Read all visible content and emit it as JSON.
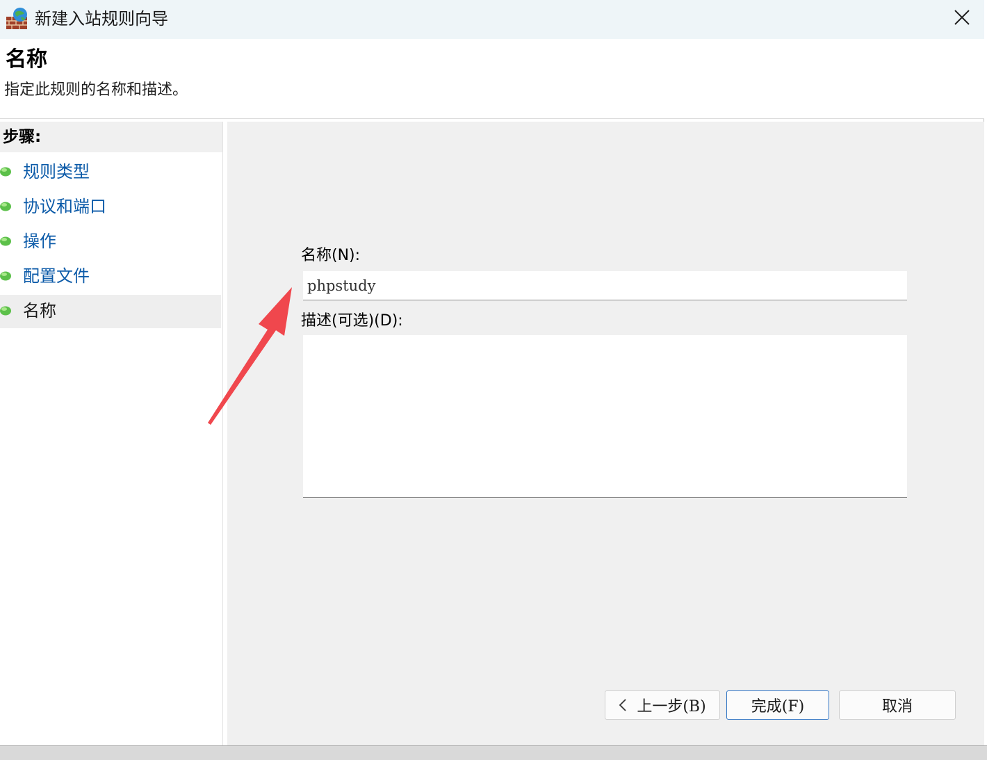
{
  "window": {
    "title": "新建入站规则向导",
    "icon": "firewall-globe-icon",
    "close_icon": "close-icon"
  },
  "header": {
    "title": "名称",
    "subtitle": "指定此规则的名称和描述。"
  },
  "sidebar": {
    "steps_label": "步骤:",
    "items": [
      {
        "label": "规则类型",
        "current": false
      },
      {
        "label": "协议和端口",
        "current": false
      },
      {
        "label": "操作",
        "current": false
      },
      {
        "label": "配置文件",
        "current": false
      },
      {
        "label": "名称",
        "current": true
      }
    ]
  },
  "form": {
    "name_label": "名称(N):",
    "name_value": "phpstudy",
    "description_label": "描述(可选)(D):",
    "description_value": ""
  },
  "buttons": {
    "back": "上一步(B)",
    "finish": "完成(F)",
    "cancel": "取消"
  },
  "colors": {
    "link": "#0b5aa8",
    "annotation_arrow": "#f0474d",
    "primary_border": "#2f74c4"
  }
}
